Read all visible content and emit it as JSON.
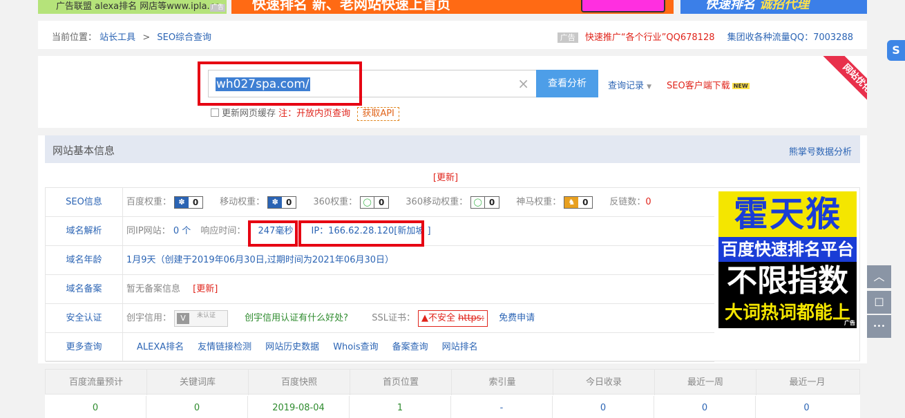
{
  "ads": {
    "top1_text": "广告联盟 alexa排名 网店等www.ipla.co",
    "top1_tag": "广告",
    "top2_text": "快速排名 新、老网站快速上首页",
    "top3_text_a": "快速排名",
    "top3_text_b": "诚招代理",
    "side": {
      "line1": "霍天猴",
      "line2": "百度快速排名平台",
      "line3": "不限指数",
      "line4": "大词热词都能上",
      "tag": "广告"
    }
  },
  "breadcrumb": {
    "prefix": "当前位置：",
    "item1": "站长工具",
    "sep": ">",
    "item2": "SEO综合查询"
  },
  "promo": {
    "adtag": "广告",
    "red_text": "快速推广“各个行业”QQ678128",
    "blue_text": "集团收各种流量QQ：7003288"
  },
  "search": {
    "value": "wh027spa.com/",
    "clear_icon": "×",
    "button": "查看分析",
    "history": "查询记录",
    "history_caret": "▼",
    "download": "SEO客户端下载",
    "download_badge": "NEW",
    "option_label": "更新网页缓存",
    "option_note": "注：开放内页查询",
    "api": "获取API",
    "ribbon": "网站优化"
  },
  "panel": {
    "title": "网站基本信息",
    "link": "熊掌号数据分析",
    "refresh": "[更新]",
    "rows": {
      "seo": {
        "label": "SEO信息",
        "baidu_label": "百度权重：",
        "baidu_val": "0",
        "mobile_label": "移动权重：",
        "mobile_val": "0",
        "r360_label": "360权重：",
        "r360_val": "0",
        "r360m_label": "360移动权重：",
        "r360m_val": "0",
        "shenma_label": "神马权重：",
        "shenma_val": "0",
        "backlinks_label": "反链数：",
        "backlinks_val": "0"
      },
      "dns": {
        "label": "域名解析",
        "sameip_label": "同IP网站：",
        "sameip_val": "0 个",
        "resp_label": "响应时间：",
        "resp_val": "247毫秒",
        "ip_val": "IP：166.62.28.120[新加坡 ]"
      },
      "age": {
        "label": "域名年龄",
        "value": "1月9天（创建于2019年06月30日,过期时间为2021年06月30日）"
      },
      "icp": {
        "label": "域名备案",
        "value": "暂无备案信息",
        "refresh": "[更新]"
      },
      "security": {
        "label": "安全认证",
        "credit_label": "创宇信用：",
        "uncert_text": "未认证",
        "benefit_link": "创宇信用认证有什么好处?",
        "ssl_label": "SSL证书：",
        "ssl_warn": "不安全",
        "ssl_https": "https:",
        "free_apply": "免费申请"
      },
      "more": {
        "label": "更多查询",
        "links": [
          "ALEXA排名",
          "友情链接检测",
          "网站历史数据",
          "Whois查询",
          "备案查询",
          "网站排名"
        ]
      }
    }
  },
  "stats": {
    "headers": [
      "百度流量预计",
      "关键词库",
      "百度快照",
      "首页位置",
      "索引量",
      "今日收录",
      "最近一周",
      "最近一月"
    ],
    "values": [
      "0",
      "0",
      "2019-08-04",
      "1",
      "-",
      "0",
      "0",
      "0"
    ]
  },
  "float": {
    "top_icon": "S",
    "up_icon": "︿",
    "chat_icon": "☐",
    "more_icon": "•••"
  }
}
